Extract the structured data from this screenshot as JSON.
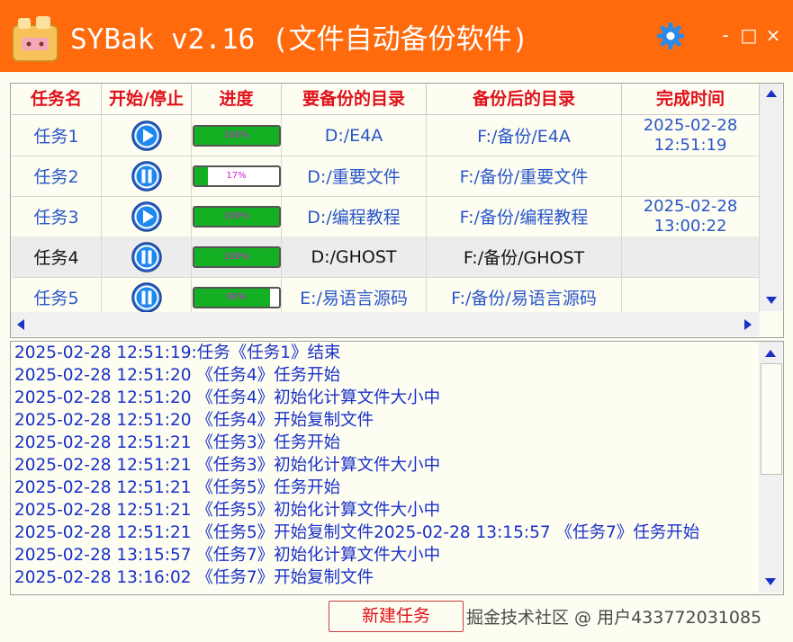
{
  "app": {
    "title": "SYBak v2.16 (文件自动备份软件)",
    "accent_color": "#ff6a0d"
  },
  "window_controls": {
    "minimize": "-",
    "maximize": "□",
    "close": "×"
  },
  "table": {
    "headers": [
      "任务名",
      "开始/停止",
      "进度",
      "要备份的目录",
      "备份后的目录",
      "完成时间"
    ],
    "rows": [
      {
        "name": "任务1",
        "action": "play",
        "progress": 100,
        "progress_label": "100%",
        "source": "D:/E4A",
        "target": "F:/备份/E4A",
        "finish_date": "2025-02-28",
        "finish_time": "12:51:19"
      },
      {
        "name": "任务2",
        "action": "pause",
        "progress": 17,
        "progress_label": "17%",
        "source": "D:/重要文件",
        "target": "F:/备份/重要文件",
        "finish_date": "",
        "finish_time": ""
      },
      {
        "name": "任务3",
        "action": "play",
        "progress": 100,
        "progress_label": "100%",
        "source": "D:/编程教程",
        "target": "F:/备份/编程教程",
        "finish_date": "2025-02-28",
        "finish_time": "13:00:22"
      },
      {
        "name": "任务4",
        "action": "pause",
        "progress": 100,
        "progress_label": "100%",
        "source": "D:/GHOST",
        "target": "F:/备份/GHOST",
        "finish_date": "",
        "finish_time": ""
      },
      {
        "name": "任务5",
        "action": "pause",
        "progress": 90,
        "progress_label": "90%",
        "source": "E:/易语言源码",
        "target": "F:/备份/易语言源码",
        "finish_date": "",
        "finish_time": ""
      }
    ]
  },
  "log": [
    "2025-02-28 12:51:19:任务《任务1》结束",
    "2025-02-28 12:51:20 《任务4》任务开始",
    "2025-02-28 12:51:20 《任务4》初始化计算文件大小中",
    "2025-02-28 12:51:20 《任务4》开始复制文件",
    "2025-02-28 12:51:21 《任务3》任务开始",
    "2025-02-28 12:51:21 《任务3》初始化计算文件大小中",
    "2025-02-28 12:51:21 《任务5》任务开始",
    "2025-02-28 12:51:21 《任务5》初始化计算文件大小中",
    "2025-02-28 12:51:21 《任务5》开始复制文件2025-02-28 13:15:57 《任务7》任务开始",
    "2025-02-28 13:15:57 《任务7》初始化计算文件大小中",
    "2025-02-28 13:16:02 《任务7》开始复制文件"
  ],
  "buttons": {
    "new_task": "新建任务"
  },
  "watermark": "掘金技术社区 @ 用户433772031085",
  "icons": {
    "logo": "app-logo-icon",
    "settings": "gear-icon",
    "play": "play-icon",
    "pause": "pause-icon"
  }
}
